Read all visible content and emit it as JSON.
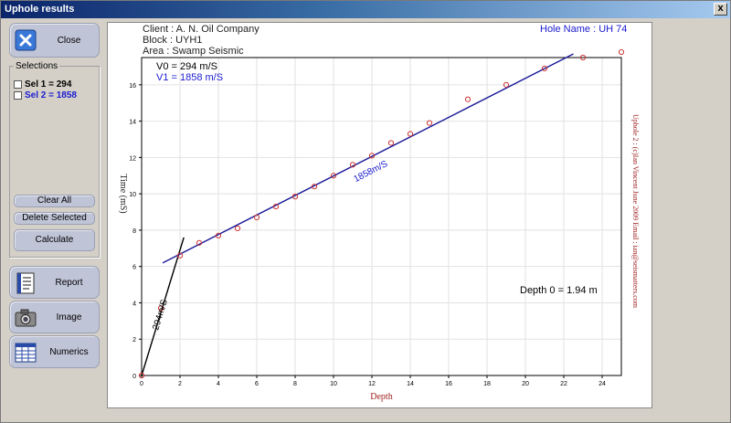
{
  "window": {
    "title": "Uphole results",
    "close_glyph": "x"
  },
  "sidebar": {
    "close_label": "Close",
    "selections_title": "Selections",
    "selections": [
      {
        "label": "Sel  1 = 294",
        "color": "#000000"
      },
      {
        "label": "Sel  2 = 1858",
        "color": "#1a1ad0"
      }
    ],
    "clear_all_label": "Clear All",
    "delete_selected_label": "Delete Selected",
    "calculate_label": "Calculate",
    "report_label": "Report",
    "image_label": "Image",
    "numerics_label": "Numerics"
  },
  "plot_header": {
    "client": "Client  : A. N. Oil Company",
    "block": "Block   : UYH1",
    "area": "Area    : Swamp Seismic",
    "hole_name": "Hole Name : UH 74"
  },
  "chart_data": {
    "type": "scatter",
    "xlabel": "Depth",
    "ylabel": "Time (mS)",
    "xlim": [
      0,
      25
    ],
    "ylim": [
      0,
      17.5
    ],
    "xticks": [
      0,
      2,
      4,
      6,
      8,
      10,
      12,
      14,
      16,
      18,
      20,
      22,
      24
    ],
    "yticks": [
      0,
      2,
      4,
      6,
      8,
      10,
      12,
      14,
      16
    ],
    "grid": true,
    "points": {
      "x": [
        0,
        1,
        2,
        3,
        4,
        5,
        6,
        7,
        8,
        9,
        10,
        11,
        12,
        13,
        14,
        15,
        17,
        19,
        21,
        23,
        25
      ],
      "y": [
        0,
        3.7,
        6.6,
        7.3,
        7.7,
        8.1,
        8.7,
        9.3,
        9.85,
        10.4,
        11.0,
        11.6,
        12.1,
        12.8,
        13.3,
        13.9,
        15.2,
        16.0,
        16.9,
        17.5,
        17.8
      ],
      "color": "#cc3333"
    },
    "fit_lines": [
      {
        "x": [
          0,
          2.2
        ],
        "y": [
          0,
          7.6
        ],
        "color": "#000000",
        "label": "294m/S",
        "label_pos": [
          1.1,
          3.3
        ],
        "label_color": "#000000"
      },
      {
        "x": [
          1.1,
          22.5
        ],
        "y": [
          6.2,
          17.7
        ],
        "color": "#1a1a9a",
        "label": "1858m/S",
        "label_pos": [
          12.0,
          11.1
        ],
        "label_color": "#1a1ad0"
      }
    ],
    "annotations": {
      "v0": "V0 =  294 m/S",
      "v1": "V1 =  1858 m/S",
      "depth0": "Depth 0 = 1.94 m",
      "credit": "Uphole 2 : (c)Ian Vincent June 2009 Email : ian@seismatters.com"
    }
  }
}
